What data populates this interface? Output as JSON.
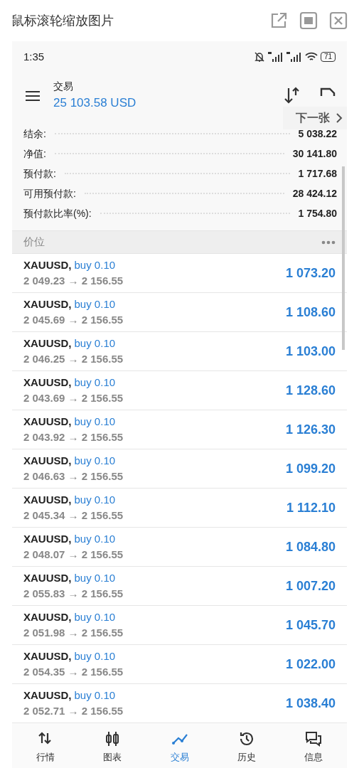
{
  "window": {
    "title": "鼠标滚轮缩放图片"
  },
  "status_bar": {
    "time": "1:35",
    "battery": "71"
  },
  "header": {
    "title": "交易",
    "balance": "25 103.58 USD"
  },
  "next_button": {
    "label": "下一张"
  },
  "summary": [
    {
      "label": "结余:",
      "value": "5 038.22"
    },
    {
      "label": "净值:",
      "value": "30 141.80"
    },
    {
      "label": "预付款:",
      "value": "1 717.68"
    },
    {
      "label": "可用预付款:",
      "value": "28 424.12"
    },
    {
      "label": "预付款比率(%):",
      "value": "1 754.80"
    }
  ],
  "section": {
    "title": "价位"
  },
  "positions": [
    {
      "symbol": "XAUUSD,",
      "side": "buy 0.10",
      "prices": "2 049.23 → 2 156.55",
      "profit": "1 073.20"
    },
    {
      "symbol": "XAUUSD,",
      "side": "buy 0.10",
      "prices": "2 045.69 → 2 156.55",
      "profit": "1 108.60"
    },
    {
      "symbol": "XAUUSD,",
      "side": "buy 0.10",
      "prices": "2 046.25 → 2 156.55",
      "profit": "1 103.00"
    },
    {
      "symbol": "XAUUSD,",
      "side": "buy 0.10",
      "prices": "2 043.69 → 2 156.55",
      "profit": "1 128.60"
    },
    {
      "symbol": "XAUUSD,",
      "side": "buy 0.10",
      "prices": "2 043.92 → 2 156.55",
      "profit": "1 126.30"
    },
    {
      "symbol": "XAUUSD,",
      "side": "buy 0.10",
      "prices": "2 046.63 → 2 156.55",
      "profit": "1 099.20"
    },
    {
      "symbol": "XAUUSD,",
      "side": "buy 0.10",
      "prices": "2 045.34 → 2 156.55",
      "profit": "1 112.10"
    },
    {
      "symbol": "XAUUSD,",
      "side": "buy 0.10",
      "prices": "2 048.07 → 2 156.55",
      "profit": "1 084.80"
    },
    {
      "symbol": "XAUUSD,",
      "side": "buy 0.10",
      "prices": "2 055.83 → 2 156.55",
      "profit": "1 007.20"
    },
    {
      "symbol": "XAUUSD,",
      "side": "buy 0.10",
      "prices": "2 051.98 → 2 156.55",
      "profit": "1 045.70"
    },
    {
      "symbol": "XAUUSD,",
      "side": "buy 0.10",
      "prices": "2 054.35 → 2 156.55",
      "profit": "1 022.00"
    },
    {
      "symbol": "XAUUSD,",
      "side": "buy 0.10",
      "prices": "2 052.71 → 2 156.55",
      "profit": "1 038.40"
    }
  ],
  "nav": [
    {
      "kind": "quotes",
      "label": "行情",
      "selected": false
    },
    {
      "kind": "chart",
      "label": "图表",
      "selected": false
    },
    {
      "kind": "trade",
      "label": "交易",
      "selected": true
    },
    {
      "kind": "history",
      "label": "历史",
      "selected": false
    },
    {
      "kind": "messages",
      "label": "信息",
      "selected": false
    }
  ]
}
